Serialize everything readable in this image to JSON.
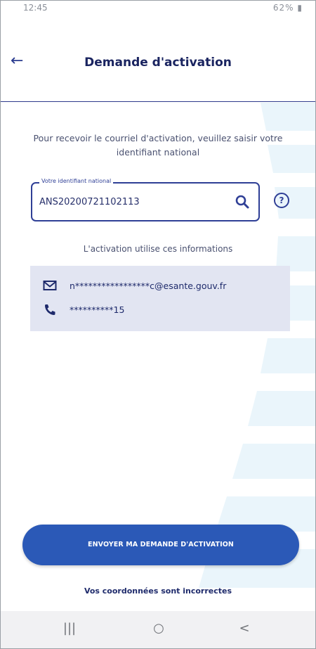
{
  "status_bar": {
    "time": "12:45",
    "right": "62%"
  },
  "header": {
    "title": "Demande d'activation"
  },
  "intro_text": "Pour recevoir le courriel d'activation, veuillez saisir votre identifiant national",
  "identifier_field": {
    "label": "Votre identifiant national",
    "value": "ANS20200721102113"
  },
  "uses_text": "L'activation utilise ces informations",
  "info": {
    "email": "n*****************c@esante.gouv.fr",
    "phone": "**********15"
  },
  "submit_button": "ENVOYER MA DEMANDE D'ACTIVATION",
  "incorrect_link": "Vos coordonnées sont incorrectes",
  "colors": {
    "primary": "#2b59b7",
    "navy": "#1e2a6b",
    "info_bg": "#e2e5f2"
  }
}
